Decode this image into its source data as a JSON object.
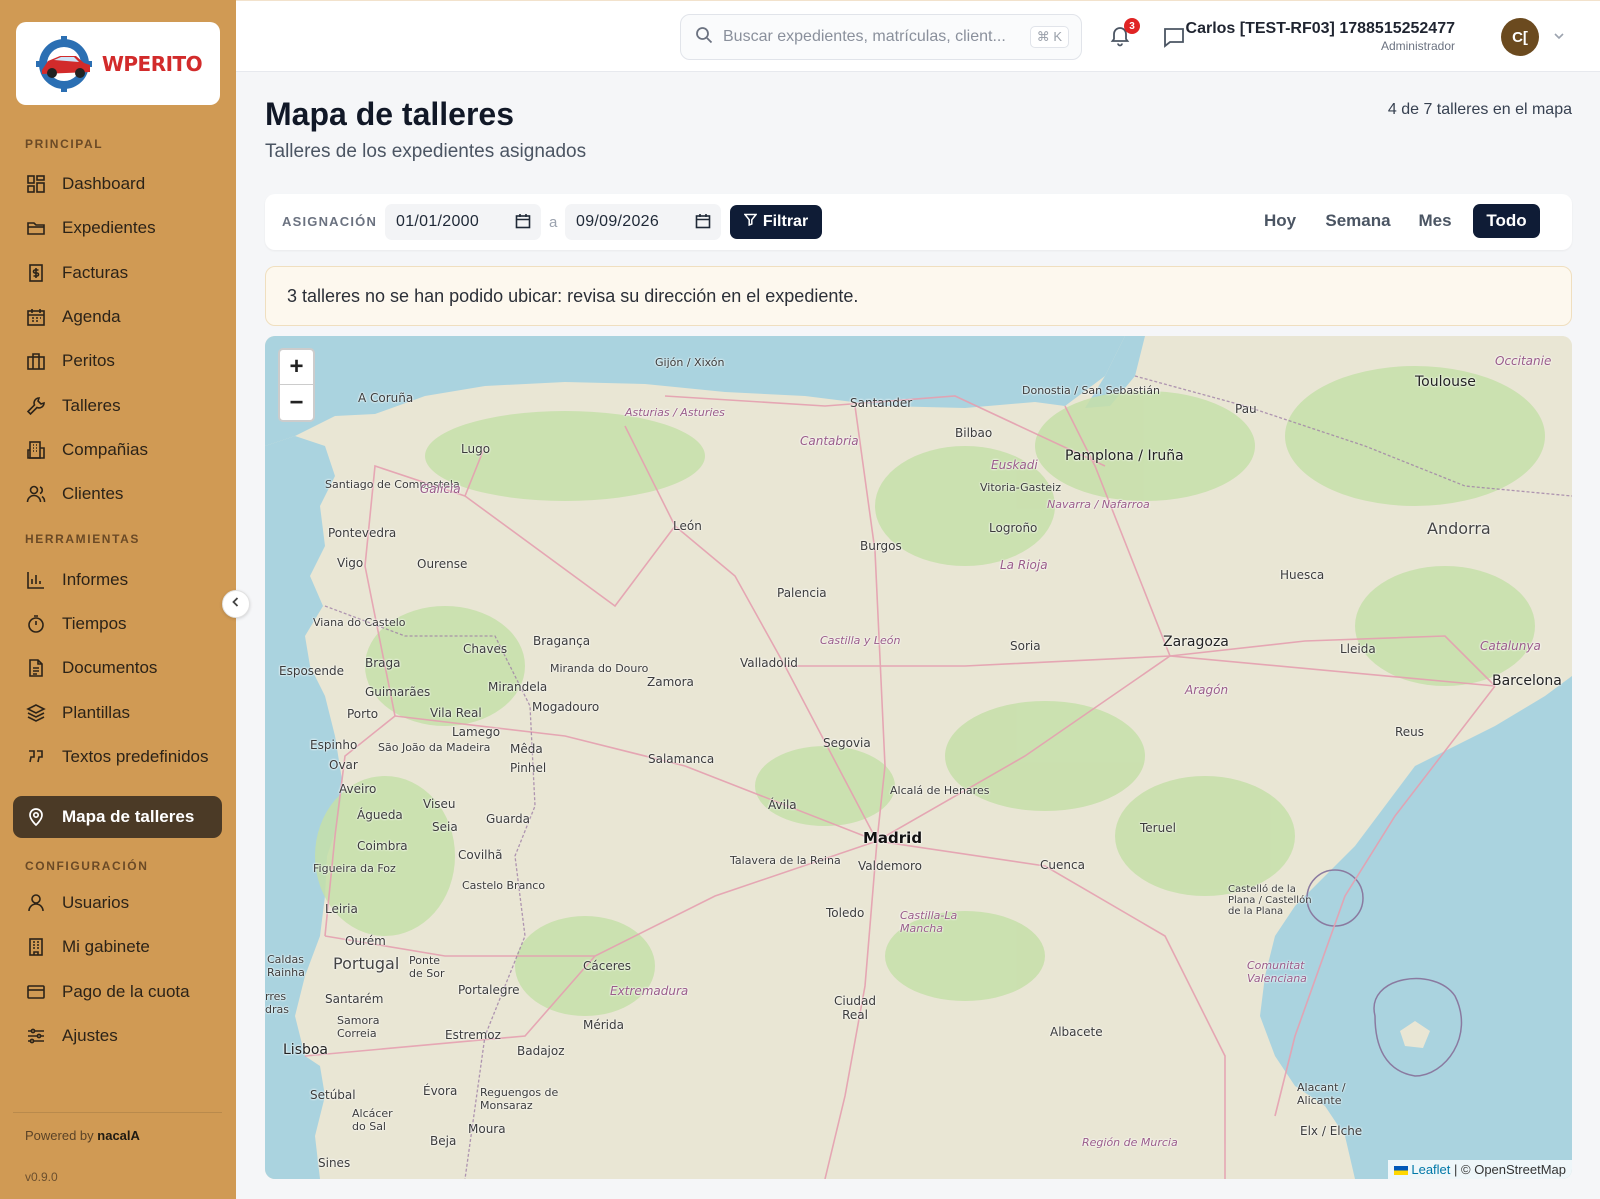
{
  "brand": {
    "logo_text": "WPERITO"
  },
  "sidebar": {
    "sections": {
      "principal": "PRINCIPAL",
      "herramientas": "HERRAMIENTAS",
      "configuracion": "CONFIGURACIÓN"
    },
    "items": [
      {
        "label": "Dashboard",
        "icon": "grid-icon"
      },
      {
        "label": "Expedientes",
        "icon": "folder-icon"
      },
      {
        "label": "Facturas",
        "icon": "invoice-icon"
      },
      {
        "label": "Agenda",
        "icon": "calendar-icon"
      },
      {
        "label": "Peritos",
        "icon": "briefcase-icon"
      },
      {
        "label": "Talleres",
        "icon": "wrench-icon"
      },
      {
        "label": "Compañias",
        "icon": "building-icon"
      },
      {
        "label": "Clientes",
        "icon": "users-icon"
      },
      {
        "label": "Informes",
        "icon": "bar-chart-icon"
      },
      {
        "label": "Tiempos",
        "icon": "timer-icon"
      },
      {
        "label": "Documentos",
        "icon": "document-icon"
      },
      {
        "label": "Plantillas",
        "icon": "layers-icon"
      },
      {
        "label": "Textos predefinidos",
        "icon": "quote-icon"
      },
      {
        "label": "Mapa de talleres",
        "icon": "map-pin-icon",
        "active": true
      },
      {
        "label": "Usuarios",
        "icon": "user-icon"
      },
      {
        "label": "Mi gabinete",
        "icon": "office-icon"
      },
      {
        "label": "Pago de la cuota",
        "icon": "credit-card-icon"
      },
      {
        "label": "Ajustes",
        "icon": "sliders-icon"
      }
    ],
    "powered_prefix": "Powered by",
    "powered_brand": "nacalA",
    "version": "v0.9.0"
  },
  "topbar": {
    "search_placeholder": "Buscar expedientes, matrículas, client...",
    "search_shortcut": "⌘ K",
    "notifications_count": "3",
    "user_name": "Carlos [TEST-RF03] 1788515252477",
    "user_role": "Administrador",
    "avatar_initials": "C["
  },
  "page": {
    "title": "Mapa de talleres",
    "subtitle": "Talleres de los expedientes asignados",
    "count_text": "4 de 7 talleres en el mapa"
  },
  "filters": {
    "label": "ASIGNACIÓN",
    "date_from": "01/01/2000",
    "date_separator": "a",
    "date_to": "09/09/2026",
    "filter_button": "Filtrar",
    "ranges": [
      "Hoy",
      "Semana",
      "Mes",
      "Todo"
    ],
    "active_range": "Todo"
  },
  "alert": {
    "text": "3 talleres no se han podido ubicar: revisa su dirección en el expediente."
  },
  "map": {
    "zoom_in": "+",
    "zoom_out": "−",
    "attribution_leaflet": "Leaflet",
    "attribution_rest": "| © OpenStreetMap",
    "labels": {
      "gijon": "Gijón / Xixón",
      "santander": "Santander",
      "donostia": "Donostia / San Sebastián",
      "toulouse": "Toulouse",
      "occitanie": "Occitanie",
      "pau": "Pau",
      "acoruna": "A Coruña",
      "asturias": "Asturias / Asturies",
      "cantabria": "Cantabria",
      "bilbao": "Bilbao",
      "pamplona": "Pamplona / Iruña",
      "lugo": "Lugo",
      "santiago": "Santiago de Compostela",
      "galicia": "Galicia",
      "euskadi": "Euskadi",
      "vitoria": "Vitoria-Gasteiz",
      "navarra": "Navarra / Nafarroa",
      "andorra": "Andorra",
      "pontevedra": "Pontevedra",
      "leon": "León",
      "logrono": "Logroño",
      "burgos": "Burgos",
      "vigo": "Vigo",
      "ourense": "Ourense",
      "larioja": "La Rioja",
      "huesca": "Huesca",
      "palencia": "Palencia",
      "vianadocastelo": "Viana do Castelo",
      "braganca": "Bragança",
      "chaves": "Chaves",
      "castillaleon": "Castilla y León",
      "soria": "Soria",
      "zaragoza": "Zaragoza",
      "lleida": "Lleida",
      "catalunya": "Catalunya",
      "esposende": "Esposende",
      "braga": "Braga",
      "mirandela": "Mirandela",
      "mirandadouro": "Miranda do Douro",
      "valladolid": "Valladolid",
      "zamora": "Zamora",
      "barcelona": "Barcelona",
      "aragon": "Aragón",
      "guimaraes": "Guimarães",
      "vilareal": "Vila Real",
      "mogadouro": "Mogadouro",
      "porto": "Porto",
      "lamego": "Lamego",
      "reus": "Reus",
      "espinho": "Espinho",
      "saojoao": "São João da Madeira",
      "meda": "Mêda",
      "salamanca": "Salamanca",
      "segovia": "Segovia",
      "ovar": "Ovar",
      "pinhel": "Pinhel",
      "aveiro": "Aveiro",
      "viseu": "Viseu",
      "alcala": "Alcalá de Henares",
      "avila": "Ávila",
      "agueda": "Águeda",
      "seia": "Seia",
      "guarda": "Guarda",
      "madrid": "Madrid",
      "teruel": "Teruel",
      "coimbra": "Coimbra",
      "covilha": "Covilhã",
      "talavera": "Talavera de la Reina",
      "valdemoro": "Valdemoro",
      "cuenca": "Cuenca",
      "figueira": "Figueira da Foz",
      "castelobranco": "Castelo Branco",
      "castello": "Castelló de la Plana / Castellón de la Plana",
      "toledo": "Toledo",
      "leiria": "Leiria",
      "castillamancha": "Castilla-La Mancha",
      "ourem": "Ourém",
      "caldas": "Caldas Rainha",
      "portugal": "Portugal",
      "pontedesor": "Ponte de Sor",
      "caceres": "Cáceres",
      "comunitat": "Comunitat Valenciana",
      "extremadura": "Extremadura",
      "portalegre": "Portalegre",
      "torres": "rres dras",
      "santarem": "Santarém",
      "ciudadreal": "Ciudad Real",
      "samora": "Samora Correia",
      "merida": "Mérida",
      "estremoz": "Estremoz",
      "albacete": "Albacete",
      "lisboa": "Lisboa",
      "badajoz": "Badajoz",
      "setubal": "Setúbal",
      "evora": "Évora",
      "reguengos": "Reguengos de Monsaraz",
      "alicante": "Alacant / Alicante",
      "alcacer": "Alcácer do Sal",
      "moura": "Moura",
      "elx": "Elx / Elche",
      "beja": "Beja",
      "sines": "Sines",
      "murcia": "Región de Murcia"
    }
  }
}
